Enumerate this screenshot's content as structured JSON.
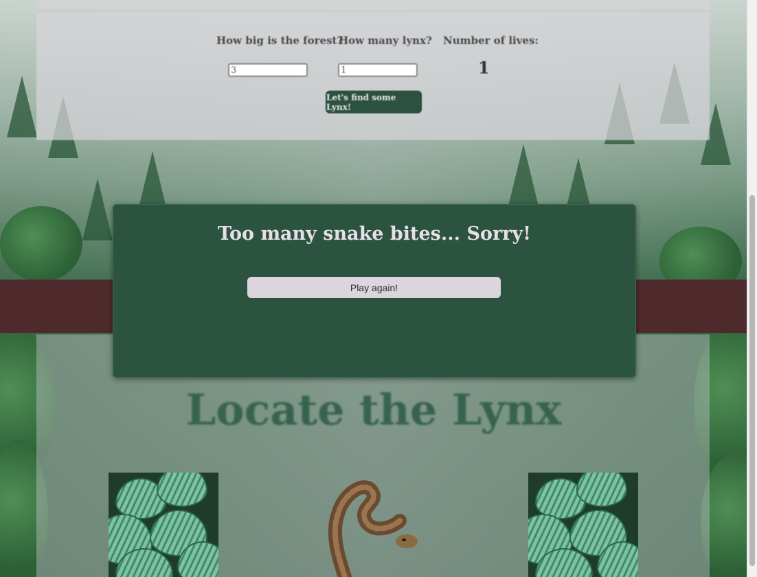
{
  "settings": {
    "forest_label": "How big is the forest?",
    "lynx_label": "How many lynx?",
    "lives_label": "Number of lives:",
    "forest_value": "3",
    "lynx_value": "1",
    "lives_value": "1",
    "find_button": "Let's find some Lynx!"
  },
  "game": {
    "title": "Locate the Lynx"
  },
  "modal": {
    "title": "Too many snake bites... Sorry!",
    "play_again": "Play again!"
  }
}
